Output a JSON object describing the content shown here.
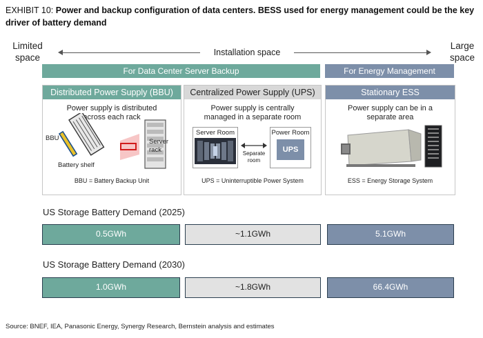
{
  "title": {
    "label": "EXHIBIT 10:",
    "text": "Power and backup configuration of data centers. BESS used for energy management could be the key driver of battery demand"
  },
  "axis": {
    "left_label": "Limited space",
    "right_label": "Large space",
    "center_label": "Installation space"
  },
  "banners": {
    "server_backup": "For Data Center Server Backup",
    "energy_mgmt": "For Energy Management"
  },
  "panels": [
    {
      "heading": "Distributed Power Supply (BBU)",
      "description": "Power supply is distributed across each rack",
      "labels": {
        "bbu": "BBU",
        "shelf": "Battery shelf",
        "rack": "Server rack"
      },
      "footnote": "BBU = Battery Backup Unit"
    },
    {
      "heading": "Centralized Power Supply (UPS)",
      "description": "Power supply is centrally managed in a separate room",
      "labels": {
        "server_room": "Server Room",
        "power_room": "Power Room",
        "separate": "Separate room",
        "ups": "UPS"
      },
      "footnote": "UPS = Uninterruptible Power System"
    },
    {
      "heading": "Stationary ESS",
      "description": "Power supply can be in a separate area",
      "footnote": "ESS = Energy Storage System"
    }
  ],
  "demand": [
    {
      "title": "US Storage Battery Demand (2025)",
      "values": [
        "0.5GWh",
        "~1.1GWh",
        "5.1GWh"
      ]
    },
    {
      "title": "US Storage Battery Demand (2030)",
      "values": [
        "1.0GWh",
        "~1.8GWh",
        "66.4GWh"
      ]
    }
  ],
  "colors": {
    "teal": "#6ea99c",
    "grey": "#e2e2e2",
    "slate": "#7d8fa9",
    "border": "#2a3e4f"
  },
  "source": "Source: BNEF, IEA, Panasonic Energy, Synergy Research, Bernstein analysis and estimates"
}
